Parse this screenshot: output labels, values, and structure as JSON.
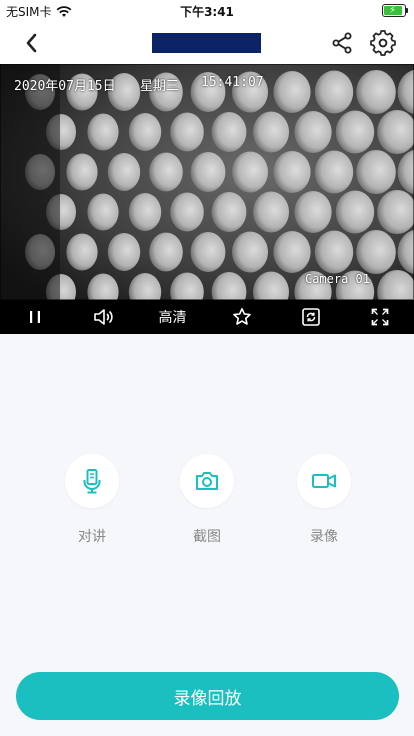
{
  "status_bar": {
    "carrier": "无SIM卡",
    "time": "下午3:41"
  },
  "nav": {
    "title": "",
    "back_icon": "chevron-left-icon",
    "share_icon": "share-icon",
    "settings_icon": "gear-icon"
  },
  "video": {
    "date": "2020年07月15日",
    "weekday": "星期三",
    "time": "15:41:07",
    "camera_label": "Camera 01"
  },
  "controls": {
    "quality_label": "高清",
    "icons": [
      "pause-icon",
      "volume-icon",
      "star-icon",
      "rotate-icon",
      "fullscreen-icon"
    ]
  },
  "actions": [
    {
      "label": "对讲",
      "icon": "microphone-icon"
    },
    {
      "label": "截图",
      "icon": "camera-icon"
    },
    {
      "label": "录像",
      "icon": "video-camera-icon"
    }
  ],
  "playback_button_label": "录像回放",
  "colors": {
    "accent": "#1bbfc0",
    "title_block": "#0c2466",
    "battery": "#3ac13a"
  }
}
